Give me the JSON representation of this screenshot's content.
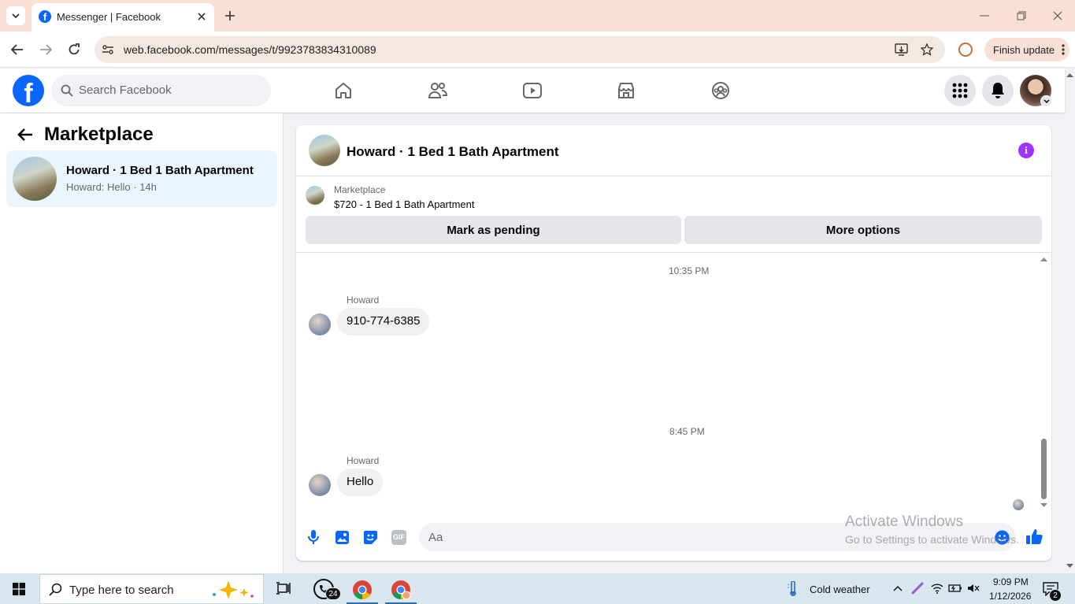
{
  "browser": {
    "tab_title": "Messenger | Facebook",
    "url": "web.facebook.com/messages/t/9923783834310089",
    "finish_update": "Finish update"
  },
  "fb": {
    "search_placeholder": "Search Facebook"
  },
  "left_pane": {
    "title": "Marketplace",
    "conversation": {
      "name": "Howard · 1 Bed 1 Bath Apartment",
      "preview": "Howard: Hello · 14h"
    }
  },
  "chat": {
    "header_title": "Howard · 1 Bed 1 Bath Apartment",
    "listing": {
      "category": "Marketplace",
      "price_title": "$720 - 1 Bed 1 Bath Apartment"
    },
    "mark_pending_label": "Mark as pending",
    "more_options_label": "More options",
    "messages": [
      {
        "time": "10:35 PM",
        "sender": "Howard",
        "text": "910-774-6385"
      },
      {
        "time": "8:45 PM",
        "sender": "Howard",
        "text": "Hello"
      }
    ],
    "composer_placeholder": "Aa",
    "gif_label": "GIF"
  },
  "watermark": {
    "line1": "Activate Windows",
    "line2": "Go to Settings to activate Windows."
  },
  "taskbar": {
    "search_placeholder": "Type here to search",
    "whatsapp_badge": "24",
    "weather": "Cold weather",
    "time": "9:09 PM",
    "date": "1/12/2026",
    "notif_count": "2"
  },
  "colors": {
    "fb_blue": "#0866ff",
    "accent_purple": "#a033ff",
    "selected_row": "#ebf5ff"
  }
}
